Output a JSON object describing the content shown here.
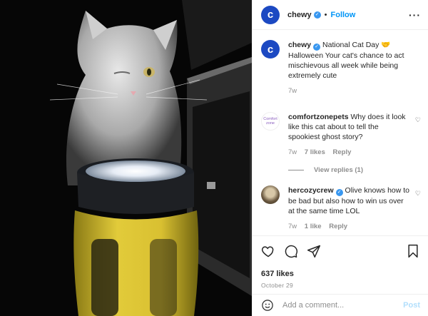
{
  "header": {
    "avatar_letter": "c",
    "username": "chewy",
    "verified_mark": "✓",
    "separator": "•",
    "follow_label": "Follow",
    "more_label": "···"
  },
  "caption": {
    "username": "chewy",
    "text": "National Cat Day 🤝 Halloween Your cat's chance to act mischievous all week while being extremely cute",
    "time": "7w"
  },
  "comments": [
    {
      "username": "comfortzonepets",
      "avatar_text": "Comfort zone",
      "text": "Why does it look like this cat about to tell the spookiest ghost story?",
      "time": "7w",
      "likes": "7 likes",
      "reply_label": "Reply",
      "view_replies": "View replies (1)"
    },
    {
      "username": "hercozycrew",
      "text": "Olive knows how to be bad but also how to win us over at the same time LOL",
      "time": "7w",
      "likes": "1 like",
      "reply_label": "Reply"
    }
  ],
  "actions": {
    "icons": [
      "heart-icon",
      "comment-icon",
      "share-icon",
      "bookmark-icon"
    ],
    "likes": "637 likes",
    "date": "October 29"
  },
  "add_comment": {
    "placeholder": "Add a comment...",
    "post_label": "Post"
  },
  "colors": {
    "brand": "#1c49c2",
    "link": "#0095f6",
    "verified": "#3897f0",
    "muted": "#8e8e8e"
  }
}
